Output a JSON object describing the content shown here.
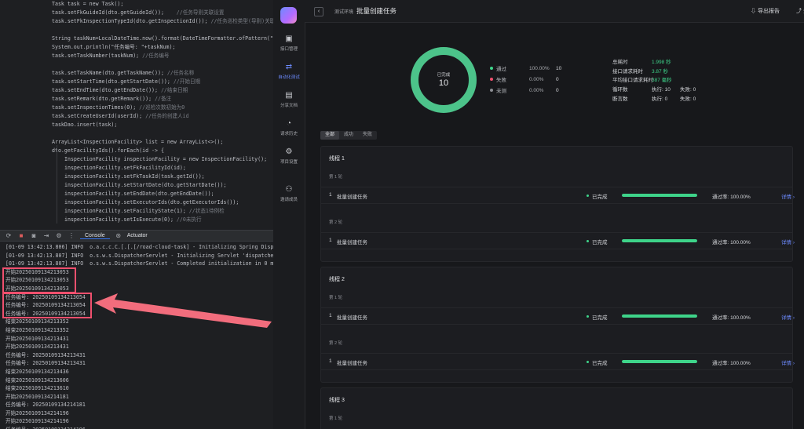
{
  "editor": {
    "lines": [
      {
        "code": "Task task = new Task();",
        "comment": ""
      },
      {
        "code": "task.setFkGuideId(dto.getGuideId());",
        "comment": "    //任务导则关联设置"
      },
      {
        "code": "task.setFkInspectionTypeId(dto.getInspectionId());",
        "comment": " //任务巡检类型(导则)关联设置"
      },
      {
        "code": "",
        "comment": ""
      },
      {
        "code": "String taskNum=LocalDateTime.now().format(DateTimeFormatter.ofPattern(\"yyyy",
        "comment": ""
      },
      {
        "code": "System.out.println(\"任务编号: \"+taskNum);",
        "comment": ""
      },
      {
        "code": "task.setTaskNumber(taskNum);",
        "comment": " //任务编号"
      },
      {
        "code": "",
        "comment": ""
      },
      {
        "code": "task.setTaskName(dto.getTaskName());",
        "comment": " //任务名称"
      },
      {
        "code": "task.setStartTime(dto.getStartDate());",
        "comment": " //开始日期"
      },
      {
        "code": "task.setEndTime(dto.getEndDate());",
        "comment": " //结束日期"
      },
      {
        "code": "task.setRemark(dto.getRemark());",
        "comment": " //备注"
      },
      {
        "code": "task.setInspectionTimes(0);",
        "comment": " //巡检次数初始为0"
      },
      {
        "code": "task.setCreateUserId(userId);",
        "comment": " //任务的创建人id"
      },
      {
        "code": "taskDao.insert(task);",
        "comment": ""
      },
      {
        "code": "",
        "comment": ""
      },
      {
        "code": "ArrayList<InspectionFacility> list = new ArrayList<>();",
        "comment": ""
      },
      {
        "code": "dto.getFacilityIds().forEach(id -> {",
        "comment": ""
      },
      {
        "code": "InspectionFacility inspectionFacility = new InspectionFacility();",
        "comment": "",
        "deep": true
      },
      {
        "code": "inspectionFacility.setFkFacilityId(id);",
        "comment": "",
        "deep": true
      },
      {
        "code": "inspectionFacility.setFkTaskId(task.getId());",
        "comment": "",
        "deep": true
      },
      {
        "code": "inspectionFacility.setStartDate(dto.getStartDate());",
        "comment": "",
        "deep": true
      },
      {
        "code": "inspectionFacility.setEndDate(dto.getEndDate());",
        "comment": "",
        "deep": true
      },
      {
        "code": "inspectionFacility.setExecutorIds(dto.getExecutorIds());",
        "comment": "",
        "deep": true
      },
      {
        "code": "inspectionFacility.setFacilityState(1);",
        "comment": " //状态1待例检",
        "deep": true
      },
      {
        "code": "inspectionFacility.setIsExecute(0);",
        "comment": " //0未执行",
        "deep": true
      }
    ]
  },
  "ide_toolbar": {
    "tabs": [
      "Console",
      "Actuator"
    ]
  },
  "console": {
    "lines": [
      "[01-09 13:42:13.806] INFO  o.a.c.c.C.[.[.[/road-cloud-task] - Initializing Spring Dispatch",
      "[01-09 13:42:13.807] INFO  o.s.w.s.DispatcherServlet - Initializing Servlet 'dispatcherSer",
      "[01-09 13:42:13.807] INFO  o.s.w.s.DispatcherServlet - Completed initialization in 0 ms",
      "开始20250109134213053",
      "开始20250109134213053",
      "开始20250109134213053",
      "任务编号: 20250109134213054",
      "任务编号: 20250109134213054",
      "任务编号: 20250109134213054",
      "结束20250109134213352",
      "结束20250109134213352",
      "开始20250109134213431",
      "开始20250109134213431",
      "任务编号: 20250109134213431",
      "任务编号: 20250109134213431",
      "结束20250109134213436",
      "结束20250109134213606",
      "结束20250109134213610",
      "开始20250109134214181",
      "任务编号: 20250109134214181",
      "开始20250109134214196",
      "开始20250109134214196",
      "任务编号: 20250109134214196"
    ]
  },
  "app": {
    "nav": [
      {
        "label": "接口管理",
        "icon": "box-icon"
      },
      {
        "label": "自动化测试",
        "icon": "flow-icon",
        "active": true
      },
      {
        "label": "分享文档",
        "icon": "doc-icon"
      },
      {
        "label": "请求历史",
        "icon": "clock-icon"
      },
      {
        "label": "项目设置",
        "icon": "gear-icon"
      },
      {
        "label": "邀请成员",
        "icon": "user-icon"
      }
    ],
    "topbar": {
      "env": "测试环境",
      "title": "批量创建任务",
      "export": "导出报告",
      "share": "分享"
    },
    "summary": {
      "donut_label": "已完成",
      "donut_value": "10",
      "legend": [
        {
          "name": "通过",
          "pct": "100.00%",
          "count": "10",
          "color": "#3ed48a"
        },
        {
          "name": "失败",
          "pct": "0.00%",
          "count": "0",
          "color": "#f0506e"
        },
        {
          "name": "未测",
          "pct": "0.00%",
          "count": "0",
          "color": "#8c8e94"
        }
      ],
      "stats": [
        {
          "label": "总耗时",
          "value": "1.998 秒",
          "green": true
        },
        {
          "label": "接口请求耗时",
          "value": "3.87 秒",
          "green": true
        },
        {
          "label": "平均接口请求耗时",
          "value": "387 毫秒",
          "green": true
        },
        {
          "label": "循环数",
          "value": "执行: 10",
          "value2": "失败: 0"
        },
        {
          "label": "断言数",
          "value": "执行: 0",
          "value2": "失败: 0"
        }
      ],
      "pass_fraction": 1.0
    },
    "filters": [
      "全部",
      "成功",
      "失败"
    ],
    "threads": [
      {
        "title": "线程 1",
        "rounds": [
          {
            "round": "第 1 轮",
            "idx": "1",
            "name": "批量创建任务",
            "status": "已完成",
            "progress": 1.0,
            "rate": "通过率: 100.00%",
            "detail": "详情"
          },
          {
            "round": "第 2 轮",
            "idx": "1",
            "name": "批量创建任务",
            "status": "已完成",
            "progress": 1.0,
            "rate": "通过率: 100.00%",
            "detail": "详情"
          }
        ]
      },
      {
        "title": "线程 2",
        "rounds": [
          {
            "round": "第 1 轮",
            "idx": "1",
            "name": "批量创建任务",
            "status": "已完成",
            "progress": 1.0,
            "rate": "通过率: 100.00%",
            "detail": "详情"
          },
          {
            "round": "第 2 轮",
            "idx": "1",
            "name": "批量创建任务",
            "status": "已完成",
            "progress": 1.0,
            "rate": "通过率: 100.00%",
            "detail": "详情"
          }
        ]
      },
      {
        "title": "线程 3",
        "rounds": [
          {
            "round": "第 1 轮"
          }
        ]
      }
    ]
  }
}
